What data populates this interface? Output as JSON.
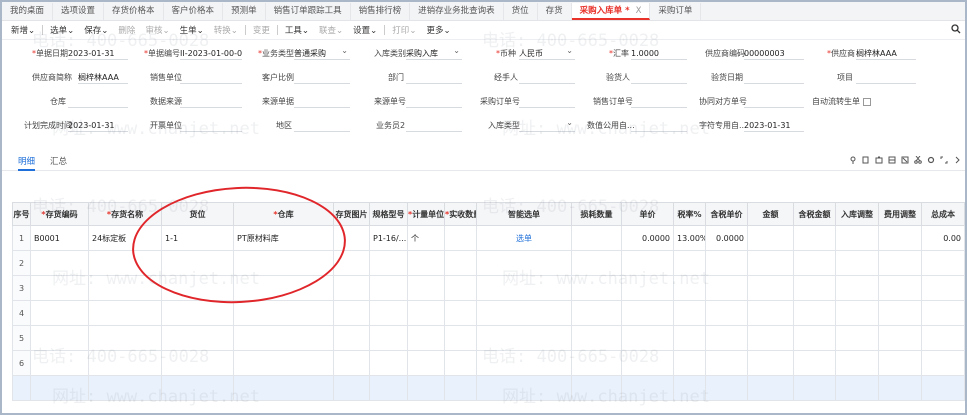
{
  "tabs": [
    {
      "label": "我的桌面"
    },
    {
      "label": "选项设置"
    },
    {
      "label": "存货价格本"
    },
    {
      "label": "客户价格本"
    },
    {
      "label": "预测单"
    },
    {
      "label": "销售订单跟踪工具"
    },
    {
      "label": "销售排行榜"
    },
    {
      "label": "进销存业务批查询表"
    },
    {
      "label": "货位"
    },
    {
      "label": "存货"
    },
    {
      "label": "采购入库单 *",
      "active": true
    },
    {
      "label": "采购订单"
    }
  ],
  "toolbar": {
    "new": "新增",
    "select": "选单",
    "save": "保存",
    "delete": "删除",
    "audit": "审核",
    "generate": "生单",
    "transfer": "转换",
    "change": "变更",
    "tools": "工具",
    "query": "联查",
    "settings": "设置",
    "print": "打印",
    "more": "更多"
  },
  "form": {
    "doc_date_label": "单据日期",
    "doc_date": "2023-01-31",
    "doc_no_label": "单据编号",
    "doc_no": "II-2023-01-00-0...",
    "biz_type_label": "业务类型",
    "biz_type": "普通采购",
    "in_type_label": "入库类别",
    "in_type": "采购入库",
    "currency_label": "币种",
    "currency": "人民币",
    "rate_label": "汇率",
    "rate": "1.0000",
    "supplier_code_label": "供应商编码",
    "supplier_code": "00000003",
    "supplier_label": "供应商",
    "supplier": "榈梓林AAA",
    "supplier_short_label": "供应商简称",
    "supplier_short": "榈梓林AAA",
    "sales_unit_label": "销售单位",
    "customer_ratio_label": "客户比例",
    "dept_label": "部门",
    "handler_label": "经手人",
    "checker_label": "验货人",
    "check_date_label": "验货日期",
    "project_label": "项目",
    "warehouse_label": "仓库",
    "data_source_label": "数据来源",
    "source_doc_label": "来源单据",
    "source_no_label": "来源单号",
    "po_no_label": "采购订单号",
    "so_no_label": "销售订单号",
    "partner_no_label": "协同对方单号",
    "auto_flow_label": "自动流转生单",
    "plan_time_label": "计划完成时间",
    "plan_time": "2023-01-31",
    "invoice_unit_label": "开票单位",
    "region_label": "地区",
    "staff2_label": "业务员2",
    "in_kind_label": "入库类型",
    "common_field_label": "数值公用自...",
    "char_field_label": "字符专用自...",
    "char_field": "2023-01-31"
  },
  "subtabs": {
    "detail": "明细",
    "summary": "汇总"
  },
  "grid": {
    "columns": [
      "序号",
      "存货编码",
      "存货名称",
      "货位",
      "仓库",
      "存货图片",
      "规格型号",
      "计量单位",
      "实收数量",
      "智能选单",
      "损耗数量",
      "单价",
      "税率%",
      "含税单价",
      "金额",
      "含税金额",
      "入库调整",
      "费用调整",
      "总成本"
    ],
    "required": [
      "存货编码",
      "存货名称",
      "仓库",
      "计量单位",
      "实收数量"
    ],
    "rows": [
      {
        "no": "1",
        "code": "B0001",
        "name": "24标定板",
        "loc": "1-1",
        "wh": "PT原材料库",
        "img": "",
        "spec": "P1-16/...",
        "unit": "个",
        "qty": "",
        "smart": "选单",
        "loss": "",
        "price": "0.0000",
        "tax": "13.00%",
        "taxprice": "0.0000",
        "amt": "",
        "taxamt": "",
        "inadj": "",
        "feeadj": "",
        "cost": "0.00"
      },
      {
        "no": "2"
      },
      {
        "no": "3"
      },
      {
        "no": "4"
      },
      {
        "no": "5"
      },
      {
        "no": "6"
      },
      {
        "no": ""
      }
    ]
  },
  "watermark": {
    "phone": "电话: 400-665-0028",
    "site": "网址: www.chanjet.net"
  }
}
